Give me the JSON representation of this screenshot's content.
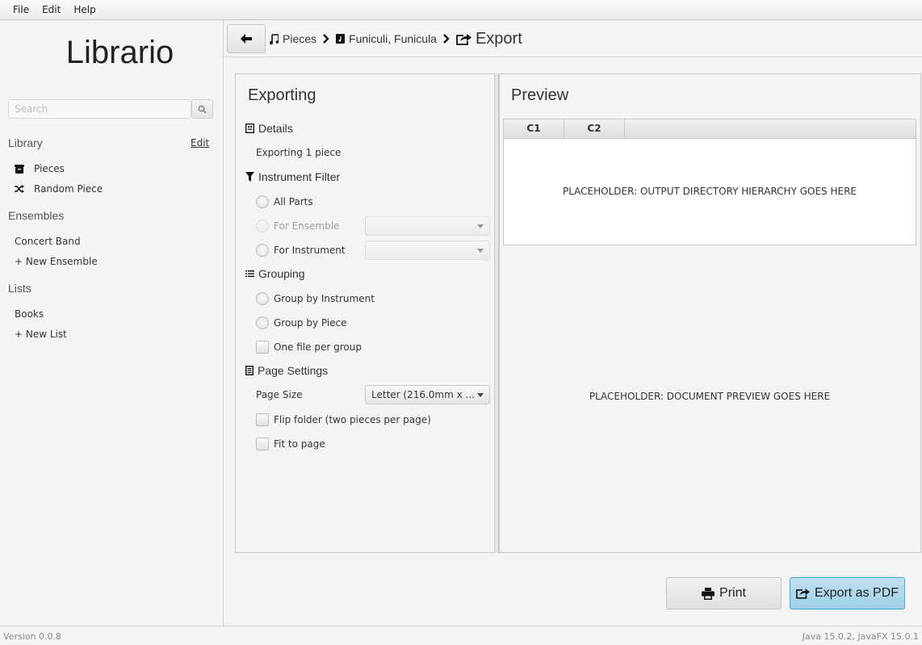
{
  "menu": [
    "File",
    "Edit",
    "Help"
  ],
  "sidebar": {
    "app_title": "Librario",
    "search_placeholder": "Search",
    "library_label": "Library",
    "edit_label": "Edit",
    "library_items": [
      {
        "label": "Pieces",
        "icon": "archive-icon"
      },
      {
        "label": "Random Piece",
        "icon": "shuffle-icon"
      }
    ],
    "ensembles_label": "Ensembles",
    "ensembles": [
      "Concert Band"
    ],
    "new_ensemble": "+ New Ensemble",
    "lists_label": "Lists",
    "lists": [
      "Books"
    ],
    "new_list": "+ New List"
  },
  "breadcrumb": {
    "items": [
      {
        "label": "Pieces",
        "icon": "music-note-icon"
      },
      {
        "label": "Funiculi, Funicula",
        "icon": "music-file-icon"
      },
      {
        "label": "Export",
        "icon": "share-icon"
      }
    ]
  },
  "exporting": {
    "title": "Exporting",
    "details_header": "Details",
    "details_text": "Exporting 1 piece",
    "filter_header": "Instrument Filter",
    "filter_options": [
      "All Parts",
      "For Ensemble",
      "For Instrument"
    ],
    "grouping_header": "Grouping",
    "grouping_options": [
      "Group by Instrument",
      "Group by Piece"
    ],
    "one_file_per_group": "One file per group",
    "page_settings_header": "Page Settings",
    "page_size_label": "Page Size",
    "page_size_value": "Letter (216.0mm x ...",
    "flip_folder": "Flip folder (two pieces per page)",
    "fit_to_page": "Fit to page"
  },
  "preview": {
    "title": "Preview",
    "columns": [
      "C1",
      "C2"
    ],
    "table_placeholder": "PLACEHOLDER: OUTPUT DIRECTORY HIERARCHY GOES HERE",
    "document_placeholder": "PLACEHOLDER: DOCUMENT PREVIEW GOES HERE"
  },
  "actions": {
    "print": "Print",
    "export_pdf": "Export as PDF"
  },
  "status": {
    "version": "Version 0.0.8",
    "runtime": "Java 15.0.2, JavaFX 15.0.1"
  }
}
